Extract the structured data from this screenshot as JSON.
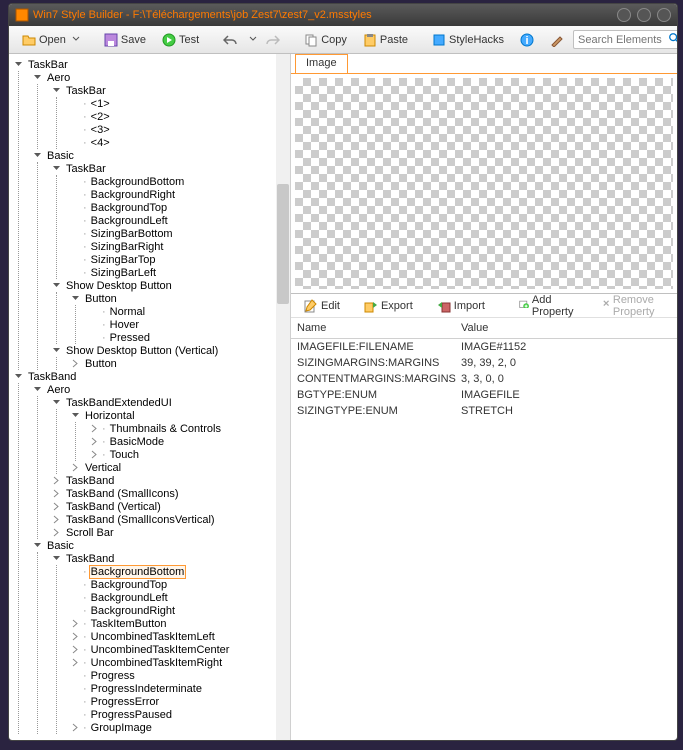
{
  "window": {
    "title": "Win7 Style Builder - F:\\Téléchargements\\job Zest7\\zest7_v2.msstyles"
  },
  "toolbar": {
    "open": "Open",
    "save": "Save",
    "test": "Test",
    "copy": "Copy",
    "paste": "Paste",
    "stylehacks": "StyleHacks",
    "search_placeholder": "Search Elements"
  },
  "tabs": {
    "image": "Image"
  },
  "props_toolbar": {
    "edit": "Edit",
    "export": "Export",
    "import": "Import",
    "add": "Add Property",
    "remove": "Remove Property"
  },
  "props_header": {
    "name": "Name",
    "value": "Value"
  },
  "props": [
    {
      "name": "IMAGEFILE:FILENAME",
      "value": "IMAGE#1152"
    },
    {
      "name": "SIZINGMARGINS:MARGINS",
      "value": "39, 39, 2, 0"
    },
    {
      "name": "CONTENTMARGINS:MARGINS",
      "value": "3, 3, 0, 0"
    },
    {
      "name": "BGTYPE:ENUM",
      "value": "IMAGEFILE"
    },
    {
      "name": "SIZINGTYPE:ENUM",
      "value": "STRETCH"
    }
  ],
  "tree": {
    "taskbar": "TaskBar",
    "aero": "Aero",
    "taskbar2": "TaskBar",
    "n1": "<1>",
    "n2": "<2>",
    "n3": "<3>",
    "n4": "<4>",
    "basic": "Basic",
    "taskbar3": "TaskBar",
    "bgBottom": "BackgroundBottom",
    "bgRight": "BackgroundRight",
    "bgTop": "BackgroundTop",
    "bgLeft": "BackgroundLeft",
    "sizBarBottom": "SizingBarBottom",
    "sizBarRight": "SizingBarRight",
    "sizBarTop": "SizingBarTop",
    "sizBarLeft": "SizingBarLeft",
    "showDesktop": "Show Desktop Button",
    "button": "Button",
    "normal": "Normal",
    "hover": "Hover",
    "pressed": "Pressed",
    "showDesktopV": "Show Desktop Button (Vertical)",
    "button2": "Button",
    "taskband": "TaskBand",
    "aero2": "Aero",
    "tbExt": "TaskBandExtendedUI",
    "horizontal": "Horizontal",
    "thumbCtrl": "Thumbnails & Controls",
    "basicMode": "BasicMode",
    "touch": "Touch",
    "vertical": "Vertical",
    "taskband2": "TaskBand",
    "tbSmallIcons": "TaskBand (SmallIcons)",
    "tbVertical": "TaskBand (Vertical)",
    "tbSmallIconsV": "TaskBand (SmallIconsVertical)",
    "scrollBar": "Scroll Bar",
    "basic2": "Basic",
    "taskband3": "TaskBand",
    "bgBottom2": "BackgroundBottom",
    "bgTop2": "BackgroundTop",
    "bgLeft2": "BackgroundLeft",
    "bgRight2": "BackgroundRight",
    "tiButton": "TaskItemButton",
    "unTiLeft": "UncombinedTaskItemLeft",
    "unTiCenter": "UncombinedTaskItemCenter",
    "unTiRight": "UncombinedTaskItemRight",
    "progress": "Progress",
    "progressInd": "ProgressIndeterminate",
    "progressErr": "ProgressError",
    "progressPaused": "ProgressPaused",
    "groupImage": "GroupImage"
  }
}
